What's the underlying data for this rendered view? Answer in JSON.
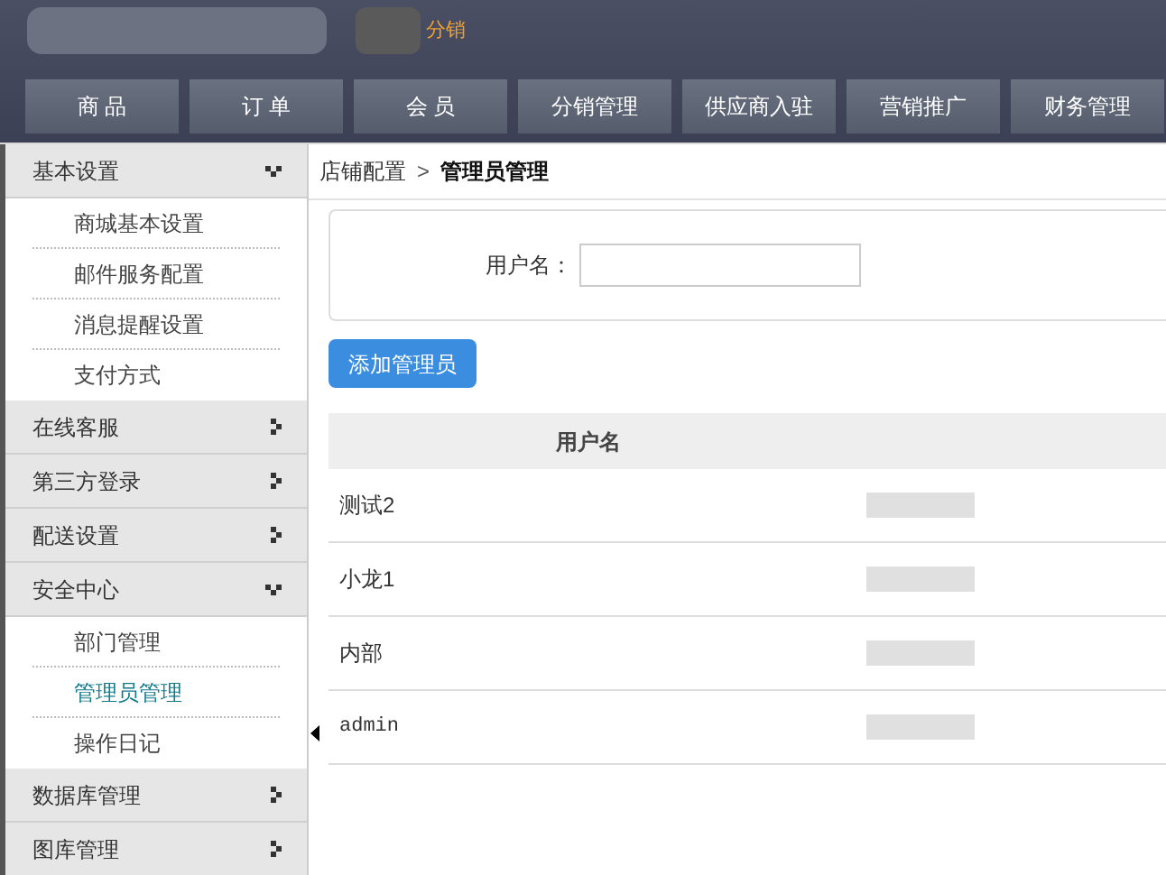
{
  "header": {
    "brand_suffix": "分销"
  },
  "nav_tabs": [
    {
      "label": "商 品"
    },
    {
      "label": "订 单"
    },
    {
      "label": "会 员"
    },
    {
      "label": "分销管理"
    },
    {
      "label": "供应商入驻"
    },
    {
      "label": "营销推广"
    },
    {
      "label": "财务管理"
    }
  ],
  "sidebar": {
    "items": [
      {
        "label": "基本设置",
        "expanded": true,
        "children": [
          {
            "label": "商城基本设置",
            "selected": false
          },
          {
            "label": "邮件服务配置",
            "selected": false
          },
          {
            "label": "消息提醒设置",
            "selected": false
          },
          {
            "label": "支付方式",
            "selected": false
          }
        ]
      },
      {
        "label": "在线客服",
        "expanded": false
      },
      {
        "label": "第三方登录",
        "expanded": false
      },
      {
        "label": "配送设置",
        "expanded": false
      },
      {
        "label": "安全中心",
        "expanded": true,
        "children": [
          {
            "label": "部门管理",
            "selected": false
          },
          {
            "label": "管理员管理",
            "selected": true
          },
          {
            "label": "操作日记",
            "selected": false
          }
        ]
      },
      {
        "label": "数据库管理",
        "expanded": false
      },
      {
        "label": "图库管理",
        "expanded": false
      }
    ]
  },
  "breadcrumb": {
    "parent": "店铺配置",
    "separator": ">",
    "current": "管理员管理"
  },
  "search": {
    "label": "用户名："
  },
  "add_button": "添加管理员",
  "table": {
    "columns": [
      "用户名"
    ],
    "rows": [
      {
        "username": "测试2",
        "kind": "text"
      },
      {
        "username": "小龙1",
        "kind": "text"
      },
      {
        "username": "内部",
        "kind": "text"
      },
      {
        "username": "admin",
        "kind": "mono"
      }
    ]
  }
}
